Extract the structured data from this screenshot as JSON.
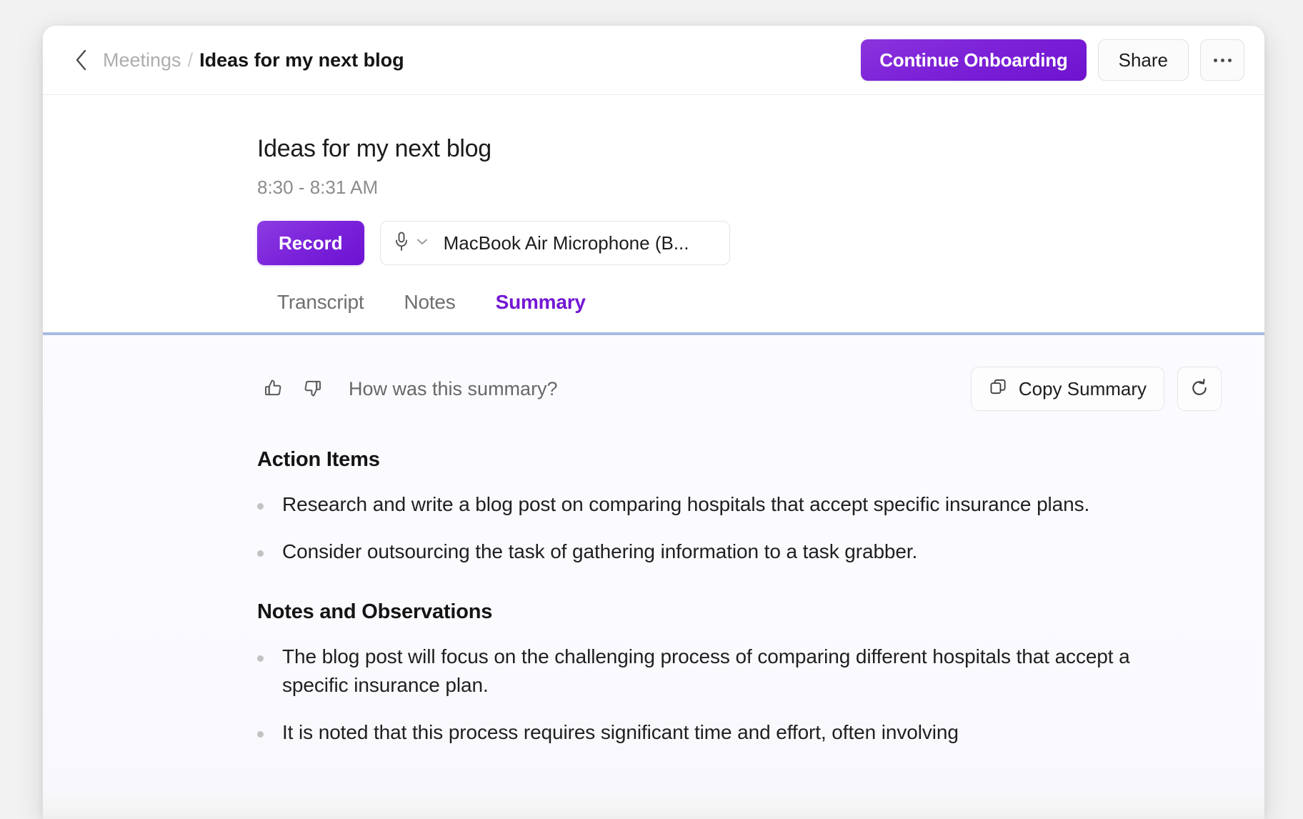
{
  "header": {
    "back_icon": "chevron-left-icon",
    "breadcrumb_parent": "Meetings",
    "breadcrumb_separator": "/",
    "breadcrumb_current": "Ideas for my next blog",
    "onboarding_label": "Continue Onboarding",
    "share_label": "Share",
    "more_icon": "ellipsis-icon",
    "accent_color": "#7317d4"
  },
  "meeting": {
    "title": "Ideas for my next blog",
    "time_range": "8:30 - 8:31 AM",
    "record_label": "Record",
    "mic_icon": "microphone-icon",
    "mic_chevron_icon": "chevron-down-icon",
    "mic_device": "MacBook Air Microphone (B..."
  },
  "tabs": [
    {
      "label": "Transcript",
      "active": false
    },
    {
      "label": "Notes",
      "active": false
    },
    {
      "label": "Summary",
      "active": true
    }
  ],
  "feedback": {
    "thumbs_up_icon": "thumbs-up-icon",
    "thumbs_down_icon": "thumbs-down-icon",
    "prompt": "How was this summary?",
    "copy_label": "Copy Summary",
    "copy_icon": "copy-icon",
    "regenerate_icon": "refresh-ccw-icon"
  },
  "summary": {
    "sections": [
      {
        "heading": "Action Items",
        "items": [
          "Research and write a blog post on comparing hospitals that accept specific insurance plans.",
          "Consider outsourcing the task of gathering information to a task grabber."
        ]
      },
      {
        "heading": "Notes and Observations",
        "items": [
          "The blog post will focus on the challenging process of comparing different hospitals that accept a specific insurance plan.",
          "It is noted that this process requires significant time and effort, often involving"
        ]
      }
    ]
  }
}
